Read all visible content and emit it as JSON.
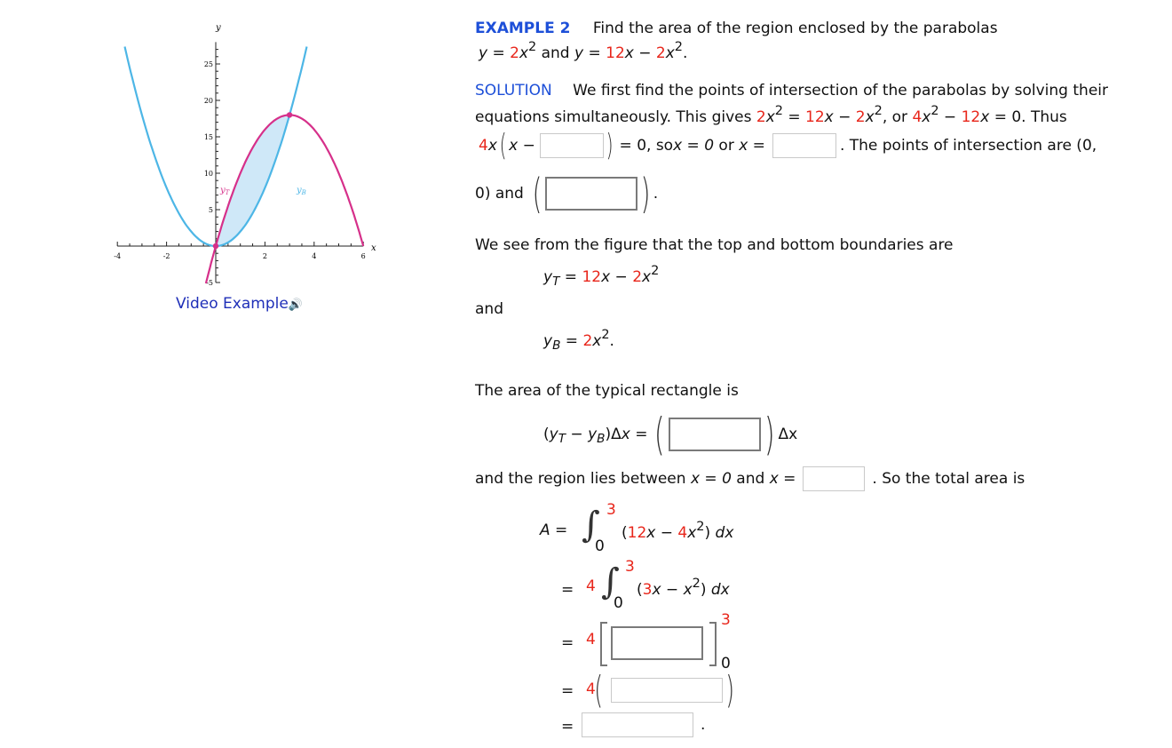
{
  "figure": {
    "axis_labels": {
      "x": "x",
      "y": "y"
    },
    "x_ticks": [
      "-4",
      "-2",
      "2",
      "4",
      "6"
    ],
    "y_ticks": [
      "25",
      "20",
      "15",
      "10",
      "5",
      "-5"
    ],
    "curve_labels": {
      "top": "yT",
      "bottom": "yB"
    },
    "colors": {
      "top": "#d6308a",
      "bottom": "#4db6e6",
      "fill": "#cfe8f8",
      "axis": "#222222"
    },
    "chart_data": {
      "type": "line",
      "series": [
        {
          "name": "yB = 2x^2",
          "x": [
            -3.7,
            -3,
            -2,
            -1,
            0,
            1,
            2,
            3,
            3.7
          ],
          "values": [
            27.38,
            18,
            8,
            2,
            0,
            2,
            8,
            18,
            27.38
          ]
        },
        {
          "name": "yT = 12x - 2x^2",
          "x": [
            -0.4,
            0,
            1,
            2,
            3,
            4,
            5,
            6
          ],
          "values": [
            -5.12,
            0,
            10,
            16,
            18,
            16,
            10,
            0
          ]
        }
      ],
      "intersection_points": [
        [
          0,
          0
        ],
        [
          3,
          18
        ]
      ],
      "shaded_region": {
        "x_from": 0,
        "x_to": 3
      },
      "xlim": [
        -4,
        6
      ],
      "ylim": [
        -5,
        28
      ]
    },
    "video_link": "Video Example",
    "speaker_icon": "speaker-icon"
  },
  "example": {
    "label": "EXAMPLE 2",
    "prompt": "Find the area of the region enclosed by the parabolas",
    "line2": {
      "y1": "y",
      "eq": " = ",
      "c1": "2",
      "x1": "x",
      "and": " and ",
      "y2": "y",
      "eq2": " = ",
      "c2": "12",
      "x2": "x",
      "minus": " − ",
      "c3": "2",
      "x3": "x",
      "end": "."
    }
  },
  "solution": {
    "label": "SOLUTION",
    "p1": "We first find the points of intersection of the parabolas by solving their",
    "p2_start": "equations simultaneously. This gives ",
    "p2_or": ", or ",
    "p2_thus": ". Thus",
    "p3_so": "= 0, so ",
    "p3_x0": "x = 0",
    "p3_or": " or ",
    "p3_x": "x =",
    "p3_end": ". The points of intersection are (0,",
    "p4": "0) and",
    "p4_end": ".",
    "boundaries": "We see from the figure that the top and bottom boundaries are",
    "and": "and",
    "area_rect": "The area of the typical rectangle is",
    "delta_x": "Δx",
    "region": "and the region lies between ",
    "region_x0": "x = 0",
    "region_and": " and ",
    "region_x": "x =",
    "region_end": ". So the total area is",
    "a_label": "A =",
    "eq": "=",
    "dx": "dx",
    "upper": "3",
    "lower": "0",
    "coef": "4"
  },
  "inputs": {
    "factor": "",
    "x_root": "",
    "point2": "",
    "rect_height": "",
    "upper_limit": "",
    "antiderivative": "",
    "evaluated": "",
    "final_answer": ""
  }
}
